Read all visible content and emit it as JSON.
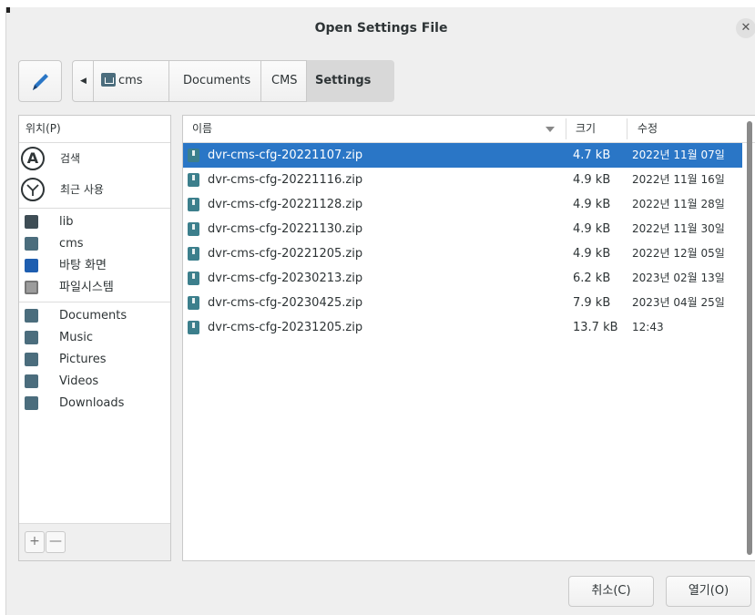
{
  "window": {
    "title": "Open Settings File",
    "close_glyph": "✕"
  },
  "pathbar": {
    "edit_icon": "pencil-icon",
    "back_glyph": "◀",
    "segments": [
      {
        "label": "cms",
        "icon": "home-folder-icon"
      },
      {
        "label": "Documents"
      },
      {
        "label": "CMS"
      },
      {
        "label": "Settings",
        "active": true
      }
    ]
  },
  "sidebar": {
    "header": "위치(P)",
    "items": [
      {
        "label": "검색",
        "icon": "search-icon"
      },
      {
        "label": "최근 사용",
        "icon": "recent-icon"
      },
      {
        "label": "lib",
        "icon": "folder-icon"
      },
      {
        "label": "cms",
        "icon": "home-folder-icon"
      },
      {
        "label": "바탕 화면",
        "icon": "desktop-icon"
      },
      {
        "label": "파일시스템",
        "icon": "drive-icon"
      },
      {
        "label": "Documents",
        "icon": "documents-folder-icon"
      },
      {
        "label": "Music",
        "icon": "music-folder-icon"
      },
      {
        "label": "Pictures",
        "icon": "pictures-folder-icon"
      },
      {
        "label": "Videos",
        "icon": "videos-folder-icon"
      },
      {
        "label": "Downloads",
        "icon": "downloads-folder-icon"
      }
    ],
    "add_glyph": "+",
    "remove_glyph": "—"
  },
  "files": {
    "columns": {
      "name": "이름",
      "size": "크기",
      "modified": "수정"
    },
    "rows": [
      {
        "name": "dvr-cms-cfg-20221107.zip",
        "size": "4.7 kB",
        "modified": "2022년 11월 07일",
        "selected": true
      },
      {
        "name": "dvr-cms-cfg-20221116.zip",
        "size": "4.9 kB",
        "modified": "2022년 11월 16일"
      },
      {
        "name": "dvr-cms-cfg-20221128.zip",
        "size": "4.9 kB",
        "modified": "2022년 11월 28일"
      },
      {
        "name": "dvr-cms-cfg-20221130.zip",
        "size": "4.9 kB",
        "modified": "2022년 11월 30일"
      },
      {
        "name": "dvr-cms-cfg-20221205.zip",
        "size": "4.9 kB",
        "modified": "2022년 12월 05일"
      },
      {
        "name": "dvr-cms-cfg-20230213.zip",
        "size": "6.2 kB",
        "modified": "2023년 02월 13일"
      },
      {
        "name": "dvr-cms-cfg-20230425.zip",
        "size": "7.9 kB",
        "modified": "2023년 04월 25일"
      },
      {
        "name": "dvr-cms-cfg-20231205.zip",
        "size": "13.7 kB",
        "modified": "12:43"
      }
    ]
  },
  "actions": {
    "cancel": "취소(C)",
    "open": "열기(O)"
  },
  "colors": {
    "selection": "#2a76c6",
    "pencil": "#2a76c6",
    "zip_icon": "#3c7f8c"
  }
}
